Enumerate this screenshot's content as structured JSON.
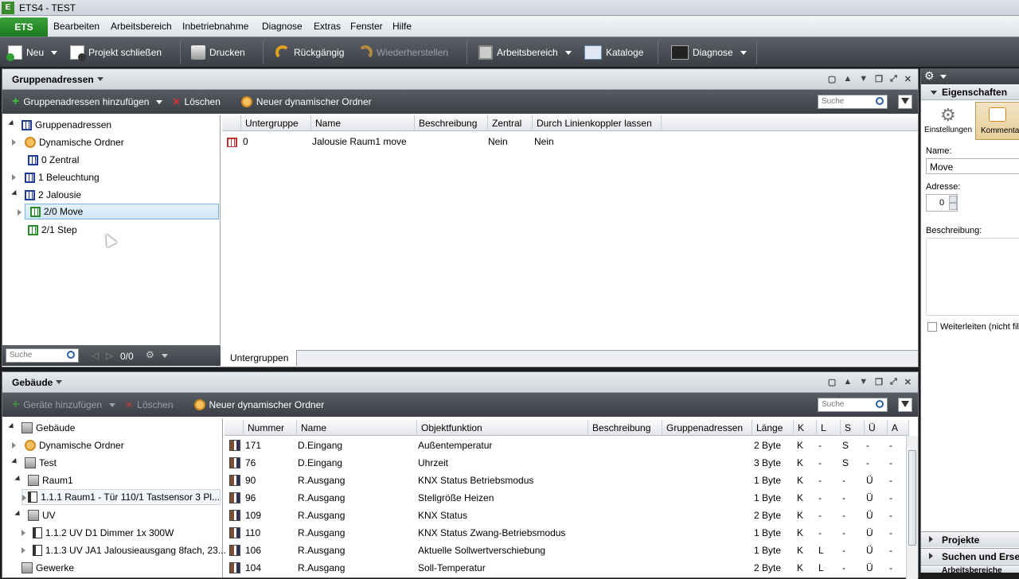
{
  "titlebar": {
    "title": "ETS4 - TEST"
  },
  "menubar": {
    "ets_label": "ETS",
    "items": [
      "Bearbeiten",
      "Arbeitsbereich",
      "Inbetriebnahme",
      "Diagnose",
      "Extras",
      "Fenster",
      "Hilfe"
    ]
  },
  "toolbar": {
    "neu": "Neu",
    "projekt_schliessen": "Projekt schließen",
    "drucken": "Drucken",
    "rueckgaengig": "Rückgängig",
    "wiederherstellen": "Wiederherstellen",
    "arbeitsbereich": "Arbeitsbereich",
    "kataloge": "Kataloge",
    "diagnose": "Diagnose"
  },
  "ga_panel": {
    "title": "Gruppenadressen",
    "add_label": "Gruppenadressen hinzufügen",
    "delete_label": "Löschen",
    "new_dyn_folder": "Neuer dynamischer Ordner",
    "search_placeholder": "Suche",
    "tree": [
      "Gruppenadressen",
      "Dynamische Ordner",
      "0 Zentral",
      "1 Beleuchtung",
      "2 Jalousie",
      "2/0 Move",
      "2/1 Step"
    ],
    "tree_search_placeholder": "Suche",
    "tree_count": "0/0",
    "columns": [
      "Untergruppe",
      "Name",
      "Beschreibung",
      "Zentral",
      "Durch Linienkoppler lassen"
    ],
    "rows": [
      {
        "untergruppe": "0",
        "name": "Jalousie Raum1 move",
        "beschreibung": "",
        "zentral": "Nein",
        "linienkoppler": "Nein"
      }
    ],
    "tab": "Untergruppen"
  },
  "geb_panel": {
    "title": "Gebäude",
    "add_label": "Geräte hinzufügen",
    "delete_label": "Löschen",
    "new_dyn_folder": "Neuer dynamischer Ordner",
    "search_placeholder": "Suche",
    "tree": [
      "Gebäude",
      "Dynamische Ordner",
      "Test",
      "Raum1",
      "1.1.1 Raum1 - Tür 110/1 Tastsensor 3 Pl...",
      "UV",
      "1.1.2 UV D1 Dimmer 1x 300W",
      "1.1.3 UV JA1 Jalousieausgang 8fach, 23...",
      "Gewerke"
    ],
    "columns": [
      "Nummer",
      "Name",
      "Objektfunktion",
      "Beschreibung",
      "Gruppenadressen",
      "Länge",
      "K",
      "L",
      "S",
      "Ü",
      "A"
    ],
    "rows": [
      {
        "nummer": "171",
        "name": "D.Eingang",
        "funktion": "Außentemperatur",
        "beschreibung": "",
        "ga": "",
        "laenge": "2 Byte",
        "k": "K",
        "l": "-",
        "s": "S",
        "u": "-",
        "a": "-"
      },
      {
        "nummer": "76",
        "name": "D.Eingang",
        "funktion": "Uhrzeit",
        "beschreibung": "",
        "ga": "",
        "laenge": "3 Byte",
        "k": "K",
        "l": "-",
        "s": "S",
        "u": "-",
        "a": "-"
      },
      {
        "nummer": "90",
        "name": "R.Ausgang",
        "funktion": "KNX Status Betriebsmodus",
        "beschreibung": "",
        "ga": "",
        "laenge": "1 Byte",
        "k": "K",
        "l": "-",
        "s": "-",
        "u": "Ü",
        "a": "-"
      },
      {
        "nummer": "96",
        "name": "R.Ausgang",
        "funktion": "Stellgröße Heizen",
        "beschreibung": "",
        "ga": "",
        "laenge": "1 Byte",
        "k": "K",
        "l": "-",
        "s": "-",
        "u": "Ü",
        "a": "-"
      },
      {
        "nummer": "109",
        "name": "R.Ausgang",
        "funktion": "KNX Status",
        "beschreibung": "",
        "ga": "",
        "laenge": "2 Byte",
        "k": "K",
        "l": "-",
        "s": "-",
        "u": "Ü",
        "a": "-"
      },
      {
        "nummer": "110",
        "name": "R.Ausgang",
        "funktion": "KNX Status Zwang-Betriebsmodus",
        "beschreibung": "",
        "ga": "",
        "laenge": "1 Byte",
        "k": "K",
        "l": "-",
        "s": "-",
        "u": "Ü",
        "a": "-"
      },
      {
        "nummer": "106",
        "name": "R.Ausgang",
        "funktion": "Aktuelle Sollwertverschiebung",
        "beschreibung": "",
        "ga": "",
        "laenge": "1 Byte",
        "k": "K",
        "l": "L",
        "s": "-",
        "u": "Ü",
        "a": "-"
      },
      {
        "nummer": "104",
        "name": "R.Ausgang",
        "funktion": "Soll-Temperatur",
        "beschreibung": "",
        "ga": "",
        "laenge": "2 Byte",
        "k": "K",
        "l": "L",
        "s": "-",
        "u": "Ü",
        "a": "-"
      }
    ]
  },
  "props": {
    "title": "Eigenschaften",
    "tab_einstellungen": "Einstellungen",
    "tab_kommentar": "Kommenta",
    "name_label": "Name:",
    "name_value": "Move",
    "adresse_label": "Adresse:",
    "adresse_value": "0",
    "beschreibung_label": "Beschreibung:",
    "weiterleiten_label": "Weiterleiten (nicht fil",
    "bottom": [
      "Projekte",
      "Suchen und Erset",
      "Arbeitsbereiche"
    ]
  }
}
